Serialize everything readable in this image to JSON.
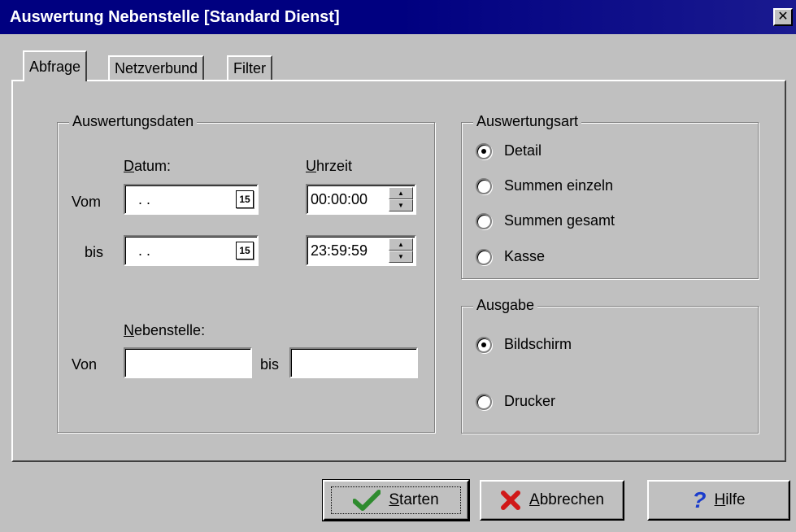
{
  "window": {
    "title": "Auswertung Nebenstelle [Standard Dienst]",
    "close_glyph": "✕"
  },
  "tabs": [
    {
      "label": "Abfrage",
      "active": true
    },
    {
      "label": "Netzverbund",
      "active": false
    },
    {
      "label": "Filter",
      "active": false
    }
  ],
  "auswertungsdaten": {
    "title": "Auswertungsdaten",
    "datum_label": "Datum:",
    "uhrzeit_label": "Uhrzeit",
    "vom_label": "Vom",
    "bis_label": "bis",
    "date_from": ". .",
    "date_to": ". .",
    "calendar_icon_text": "15",
    "time_from": "00:00:00",
    "time_to": "23:59:59",
    "nebenstelle_label": "Nebenstelle:",
    "von_label": "Von",
    "bis2_label": "bis",
    "nebenstelle_from": "",
    "nebenstelle_to": ""
  },
  "auswertungsart": {
    "title": "Auswertungsart",
    "options": [
      {
        "label": "Detail",
        "checked": true
      },
      {
        "label": "Summen einzeln",
        "checked": false
      },
      {
        "label": "Summen gesamt",
        "checked": false
      },
      {
        "label": "Kasse",
        "checked": false
      }
    ]
  },
  "ausgabe": {
    "title": "Ausgabe",
    "options": [
      {
        "label": "Bildschirm",
        "checked": true
      },
      {
        "label": "Drucker",
        "checked": false
      }
    ]
  },
  "buttons": {
    "start_label": "Starten",
    "cancel_label": "Abbrechen",
    "help_label": "Hilfe",
    "start_icon": "checkmark-icon",
    "cancel_icon": "x-icon",
    "help_icon": "question-mark-icon"
  },
  "colors": {
    "titlebar": "#000080",
    "face": "#c0c0c0",
    "check_green": "#2e8b2e",
    "cancel_red": "#d01818",
    "help_blue": "#1a3ccc"
  }
}
